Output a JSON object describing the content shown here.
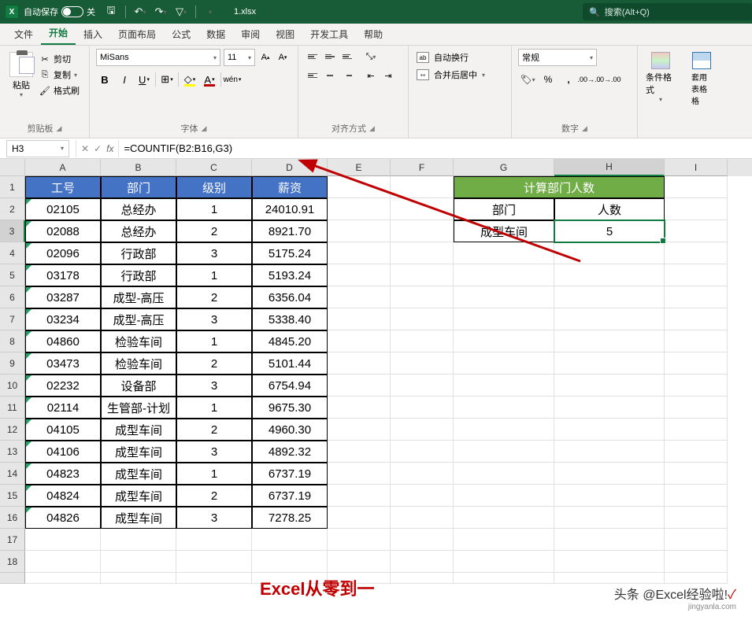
{
  "titlebar": {
    "autosave_label": "自动保存",
    "autosave_state": "关",
    "filename": "1.xlsx",
    "search_placeholder": "搜索(Alt+Q)"
  },
  "tabs": {
    "file": "文件",
    "home": "开始",
    "insert": "插入",
    "layout": "页面布局",
    "formula": "公式",
    "data": "数据",
    "review": "审阅",
    "view": "视图",
    "dev": "开发工具",
    "help": "帮助"
  },
  "ribbon": {
    "clipboard": {
      "paste": "粘贴",
      "cut": "剪切",
      "copy": "复制",
      "painter": "格式刷",
      "group": "剪贴板"
    },
    "font": {
      "name": "MiSans",
      "size": "11",
      "group": "字体"
    },
    "align": {
      "wrap": "自动换行",
      "merge": "合并后居中",
      "group": "对齐方式"
    },
    "number": {
      "format": "常规",
      "group": "数字"
    },
    "styles": {
      "cond": "条件格式",
      "table": "套用\n表格格"
    }
  },
  "formula_bar": {
    "cell_ref": "H3",
    "formula": "=COUNTIF(B2:B16,G3)"
  },
  "columns": [
    "A",
    "B",
    "C",
    "D",
    "E",
    "F",
    "G",
    "H",
    "I"
  ],
  "header_row": {
    "a": "工号",
    "b": "部门",
    "c": "级别",
    "d": "薪资"
  },
  "data_rows": [
    {
      "a": "02105",
      "b": "总经办",
      "c": "1",
      "d": "24010.91"
    },
    {
      "a": "02088",
      "b": "总经办",
      "c": "2",
      "d": "8921.70"
    },
    {
      "a": "02096",
      "b": "行政部",
      "c": "3",
      "d": "5175.24"
    },
    {
      "a": "03178",
      "b": "行政部",
      "c": "1",
      "d": "5193.24"
    },
    {
      "a": "03287",
      "b": "成型-高压",
      "c": "2",
      "d": "6356.04"
    },
    {
      "a": "03234",
      "b": "成型-高压",
      "c": "3",
      "d": "5338.40"
    },
    {
      "a": "04860",
      "b": "检验车间",
      "c": "1",
      "d": "4845.20"
    },
    {
      "a": "03473",
      "b": "检验车间",
      "c": "2",
      "d": "5101.44"
    },
    {
      "a": "02232",
      "b": "设备部",
      "c": "3",
      "d": "6754.94"
    },
    {
      "a": "02114",
      "b": "生管部-计划",
      "c": "1",
      "d": "9675.30"
    },
    {
      "a": "04105",
      "b": "成型车间",
      "c": "2",
      "d": "4960.30"
    },
    {
      "a": "04106",
      "b": "成型车间",
      "c": "3",
      "d": "4892.32"
    },
    {
      "a": "04823",
      "b": "成型车间",
      "c": "1",
      "d": "6737.19"
    },
    {
      "a": "04824",
      "b": "成型车间",
      "c": "2",
      "d": "6737.19"
    },
    {
      "a": "04826",
      "b": "成型车间",
      "c": "3",
      "d": "7278.25"
    }
  ],
  "side_table": {
    "title": "计算部门人数",
    "h_dept": "部门",
    "h_count": "人数",
    "dept_val": "成型车间",
    "count_val": "5"
  },
  "watermark": {
    "text": "Excel从零到一",
    "credit": "头条 @Excel经验啦!",
    "url": "jingyanla.com"
  }
}
